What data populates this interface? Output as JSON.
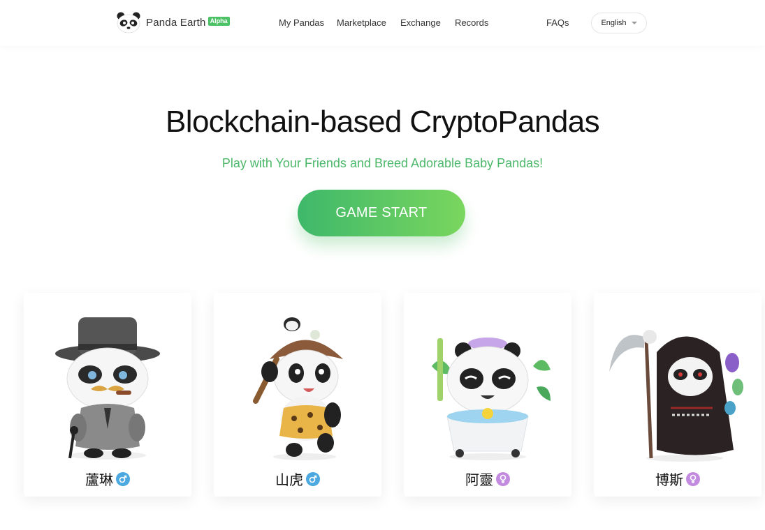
{
  "header": {
    "brand": "Panda Earth",
    "badge": "Alpha",
    "nav": [
      "My Pandas",
      "Marketplace",
      "Exchange",
      "Records"
    ],
    "faqs": "FAQs",
    "language": "English"
  },
  "hero": {
    "title": "Blockchain-based CryptoPandas",
    "subtitle": "Play with Your Friends and Breed Adorable Baby Pandas!",
    "cta": "GAME START"
  },
  "cards": [
    {
      "name": "蘆琳",
      "gender": "male",
      "gender_icon": "male-icon",
      "character": "gentleman-panda"
    },
    {
      "name": "山虎",
      "gender": "male",
      "gender_icon": "male-icon",
      "character": "caveman-panda"
    },
    {
      "name": "阿靈",
      "gender": "female",
      "gender_icon": "female-icon",
      "character": "bath-panda"
    },
    {
      "name": "博斯",
      "gender": "female",
      "gender_icon": "female-icon",
      "character": "reaper-panda"
    }
  ],
  "colors": {
    "accent_green": "#4cb86a",
    "badge_green": "#4cc267",
    "male_badge": "#4ba8e0",
    "female_badge": "#c28be0"
  }
}
